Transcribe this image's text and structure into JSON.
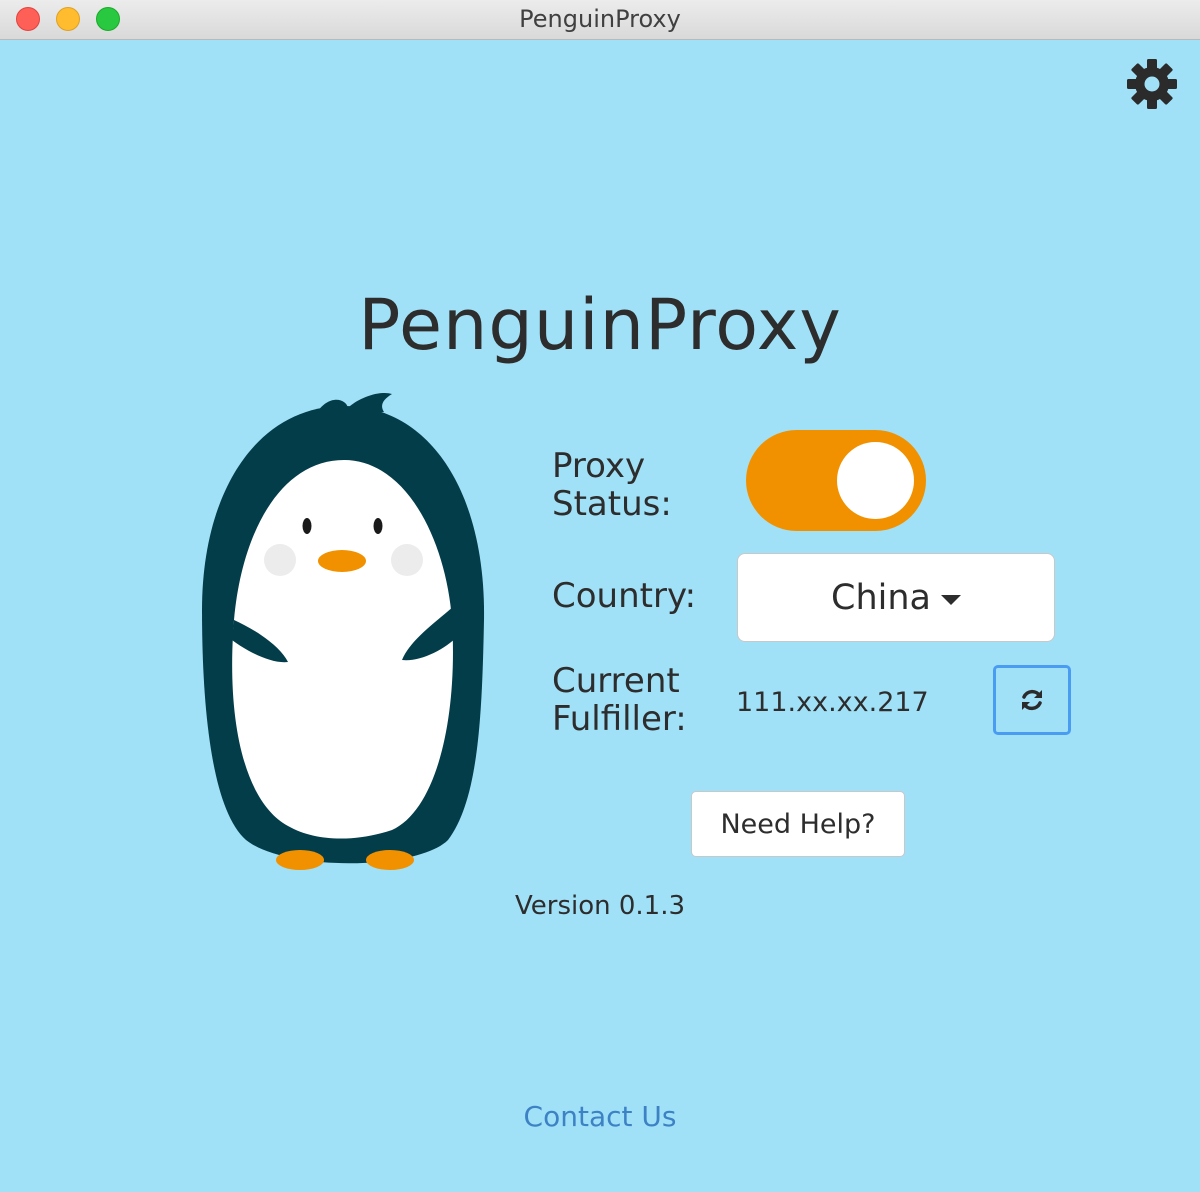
{
  "window": {
    "title": "PenguinProxy"
  },
  "header": {
    "app_title": "PenguinProxy",
    "settings_icon": "gear-icon"
  },
  "proxy_status": {
    "label": "Proxy\nStatus:",
    "enabled": true,
    "toggle_color": "#f29100"
  },
  "country": {
    "label": "Country:",
    "selected": "China"
  },
  "fulfiller": {
    "label": "Current\nFulfiller:",
    "ip": "111.xx.xx.217",
    "refresh_icon": "refresh-icon"
  },
  "help": {
    "button_label": "Need Help?"
  },
  "footer": {
    "version": "Version 0.1.3",
    "contact_link": "Contact Us"
  },
  "colors": {
    "background": "#a1e1f8",
    "accent": "#f29100",
    "link": "#3d82c4",
    "penguin_body": "#043d4a"
  }
}
